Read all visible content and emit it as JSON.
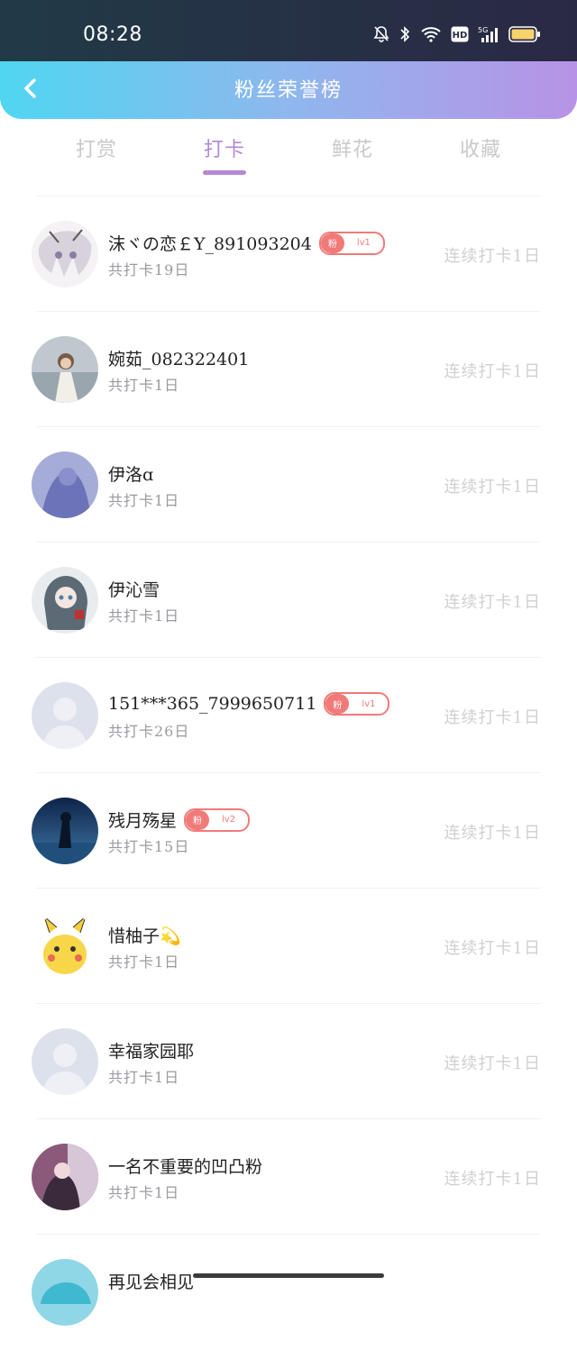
{
  "status_bar": {
    "time": "08:28",
    "battery_color": "#f7d36b"
  },
  "header": {
    "title": "粉丝荣誉榜",
    "back_icon": "chevron-left-icon"
  },
  "tabs": [
    {
      "label": "打赏",
      "active": false
    },
    {
      "label": "打卡",
      "active": true
    },
    {
      "label": "鲜花",
      "active": false
    },
    {
      "label": "收藏",
      "active": false
    }
  ],
  "fans": [
    {
      "name": "沫ヾの恋￡Y_891093204",
      "total": "共打卡19日",
      "streak": "连续打卡1日",
      "badge": {
        "fan": "粉",
        "level": "lv1"
      }
    },
    {
      "name": "婉茹_082322401",
      "total": "共打卡1日",
      "streak": "连续打卡1日"
    },
    {
      "name": "伊洛ɑ",
      "total": "共打卡1日",
      "streak": "连续打卡1日"
    },
    {
      "name": "伊沁雪",
      "total": "共打卡1日",
      "streak": "连续打卡1日"
    },
    {
      "name": "151***365_7999650711",
      "total": "共打卡26日",
      "streak": "连续打卡1日",
      "badge": {
        "fan": "粉",
        "level": "lv1"
      }
    },
    {
      "name": "残月殇星",
      "total": "共打卡15日",
      "streak": "连续打卡1日",
      "badge": {
        "fan": "粉",
        "level": "lv2"
      }
    },
    {
      "name": "惜柚子💫",
      "total": "共打卡1日",
      "streak": "连续打卡1日"
    },
    {
      "name": "幸福家园耶",
      "total": "共打卡1日",
      "streak": "连续打卡1日"
    },
    {
      "name": "一名不重要的凹凸粉",
      "total": "共打卡1日",
      "streak": "连续打卡1日"
    },
    {
      "name": "再见会相见",
      "total": "",
      "streak": ""
    }
  ]
}
